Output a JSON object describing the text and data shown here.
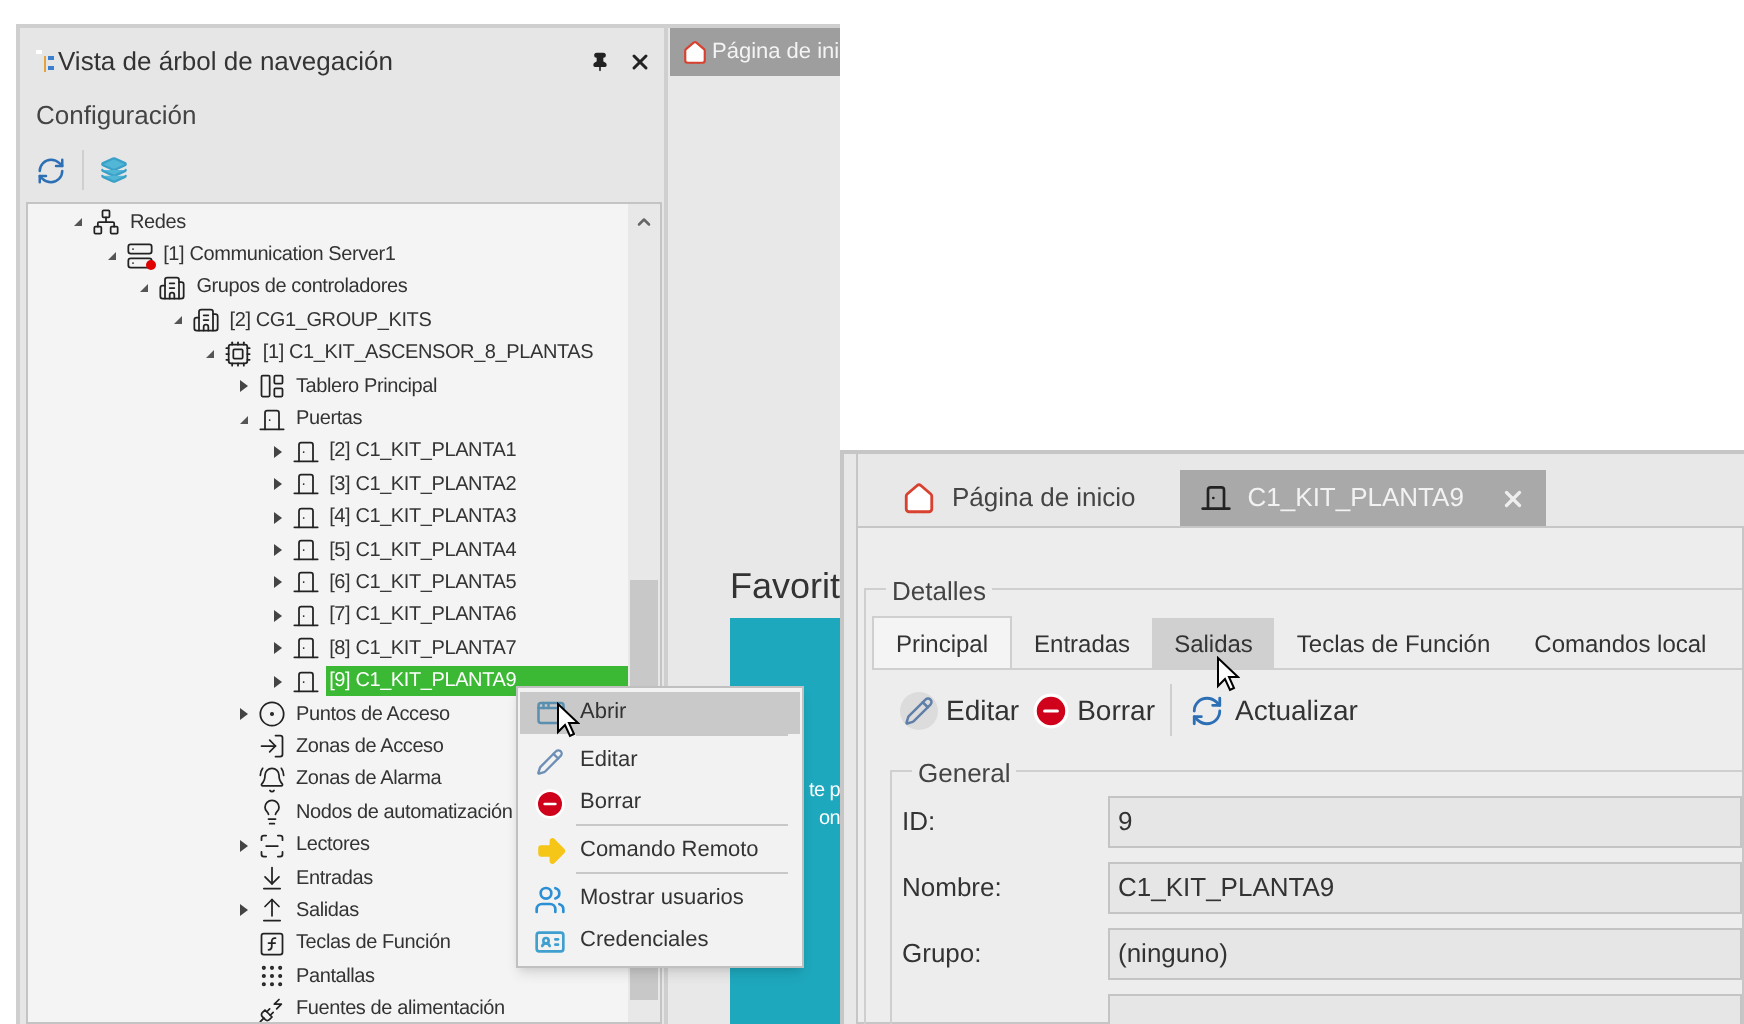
{
  "nav_panel": {
    "title": "Vista de árbol de navegación",
    "section": "Configuración",
    "tree": [
      {
        "label": "Redes",
        "kind": "network",
        "expanded": true,
        "selected": false,
        "children": [
          {
            "label": "[1] Communication Server1",
            "kind": "server",
            "expanded": true,
            "selected": false,
            "children": [
              {
                "label": "Grupos de controladores",
                "kind": "group",
                "expanded": true,
                "selected": false,
                "children": [
                  {
                    "label": "[2] CG1_GROUP_KITS",
                    "kind": "group",
                    "expanded": true,
                    "selected": false,
                    "children": [
                      {
                        "label": "[1] C1_KIT_ASCENSOR_8_PLANTAS",
                        "kind": "controller",
                        "expanded": true,
                        "selected": false,
                        "children": [
                          {
                            "label": "Tablero Principal",
                            "kind": "panel",
                            "expanded": false,
                            "selected": false
                          },
                          {
                            "label": "Puertas",
                            "kind": "door",
                            "expanded": true,
                            "selected": false,
                            "children": [
                              {
                                "label": "[2] C1_KIT_PLANTA1",
                                "kind": "door",
                                "expanded": false,
                                "selected": false
                              },
                              {
                                "label": "[3] C1_KIT_PLANTA2",
                                "kind": "door",
                                "expanded": false,
                                "selected": false
                              },
                              {
                                "label": "[4] C1_KIT_PLANTA3",
                                "kind": "door",
                                "expanded": false,
                                "selected": false
                              },
                              {
                                "label": "[5] C1_KIT_PLANTA4",
                                "kind": "door",
                                "expanded": false,
                                "selected": false
                              },
                              {
                                "label": "[6] C1_KIT_PLANTA5",
                                "kind": "door",
                                "expanded": false,
                                "selected": false
                              },
                              {
                                "label": "[7] C1_KIT_PLANTA6",
                                "kind": "door",
                                "expanded": false,
                                "selected": false
                              },
                              {
                                "label": "[8] C1_KIT_PLANTA7",
                                "kind": "door",
                                "expanded": false,
                                "selected": false
                              },
                              {
                                "label": "[9] C1_KIT_PLANTA9",
                                "kind": "door",
                                "expanded": false,
                                "selected": true
                              }
                            ]
                          },
                          {
                            "label": "Puntos de Acceso",
                            "kind": "access-point",
                            "expanded": false,
                            "selected": false
                          },
                          {
                            "label": "Zonas de Acceso",
                            "kind": "access-zone",
                            "selected": false
                          },
                          {
                            "label": "Zonas de Alarma",
                            "kind": "alarm-zone",
                            "selected": false
                          },
                          {
                            "label": "Nodos de automatización",
                            "kind": "automation",
                            "selected": false
                          },
                          {
                            "label": "Lectores",
                            "kind": "reader",
                            "expanded": false,
                            "selected": false
                          },
                          {
                            "label": "Entradas",
                            "kind": "input",
                            "selected": false
                          },
                          {
                            "label": "Salidas",
                            "kind": "output",
                            "expanded": false,
                            "selected": false
                          },
                          {
                            "label": "Teclas de Función",
                            "kind": "function-key",
                            "selected": false
                          },
                          {
                            "label": "Pantallas",
                            "kind": "screen",
                            "selected": false
                          },
                          {
                            "label": "Fuentes de alimentación",
                            "kind": "power",
                            "selected": false
                          }
                        ]
                      }
                    ]
                  }
                ]
              }
            ]
          }
        ]
      }
    ]
  },
  "context_menu": [
    {
      "label": "Abrir",
      "kind": "open",
      "hovered": true,
      "divider_above": false
    },
    {
      "label": "Editar",
      "kind": "edit",
      "hovered": false,
      "divider_above": true
    },
    {
      "label": "Borrar",
      "kind": "delete",
      "hovered": false,
      "divider_above": false
    },
    {
      "label": "Comando Remoto",
      "kind": "remote",
      "hovered": false,
      "divider_above": true
    },
    {
      "label": "Mostrar usuarios",
      "kind": "users",
      "hovered": false,
      "divider_above": true
    },
    {
      "label": "Credenciales",
      "kind": "credentials",
      "hovered": false,
      "divider_above": false
    }
  ],
  "background_document": {
    "tabs": [
      {
        "label": "Página de ini",
        "selected": true
      }
    ],
    "heading": "Favorit",
    "card_lines": [
      "te p",
      "on"
    ]
  },
  "detail_window": {
    "tabs": [
      {
        "label": "Página de inicio",
        "kind": "home",
        "selected": false,
        "closable": false
      },
      {
        "label": "C1_KIT_PLANTA9",
        "kind": "door",
        "selected": true,
        "closable": true
      }
    ],
    "group": "Detalles",
    "subtabs": [
      {
        "label": "Principal",
        "selected": true,
        "hovered": false
      },
      {
        "label": "Entradas",
        "selected": false,
        "hovered": false
      },
      {
        "label": "Salidas",
        "selected": false,
        "hovered": true
      },
      {
        "label": "Teclas de Función",
        "selected": false,
        "hovered": false
      },
      {
        "label": "Comandos local",
        "selected": false,
        "hovered": false
      }
    ],
    "toolbar": [
      {
        "label": "Editar",
        "kind": "edit",
        "divider_before": false
      },
      {
        "label": "Borrar",
        "kind": "delete",
        "divider_before": false
      },
      {
        "label": "Actualizar",
        "kind": "refresh",
        "divider_before": true
      }
    ],
    "general": {
      "title": "General",
      "fields": [
        {
          "label": "ID:",
          "value": "9"
        },
        {
          "label": "Nombre:",
          "value": "C1_KIT_PLANTA9"
        },
        {
          "label": "Grupo:",
          "value": "(ninguno)"
        }
      ]
    }
  }
}
